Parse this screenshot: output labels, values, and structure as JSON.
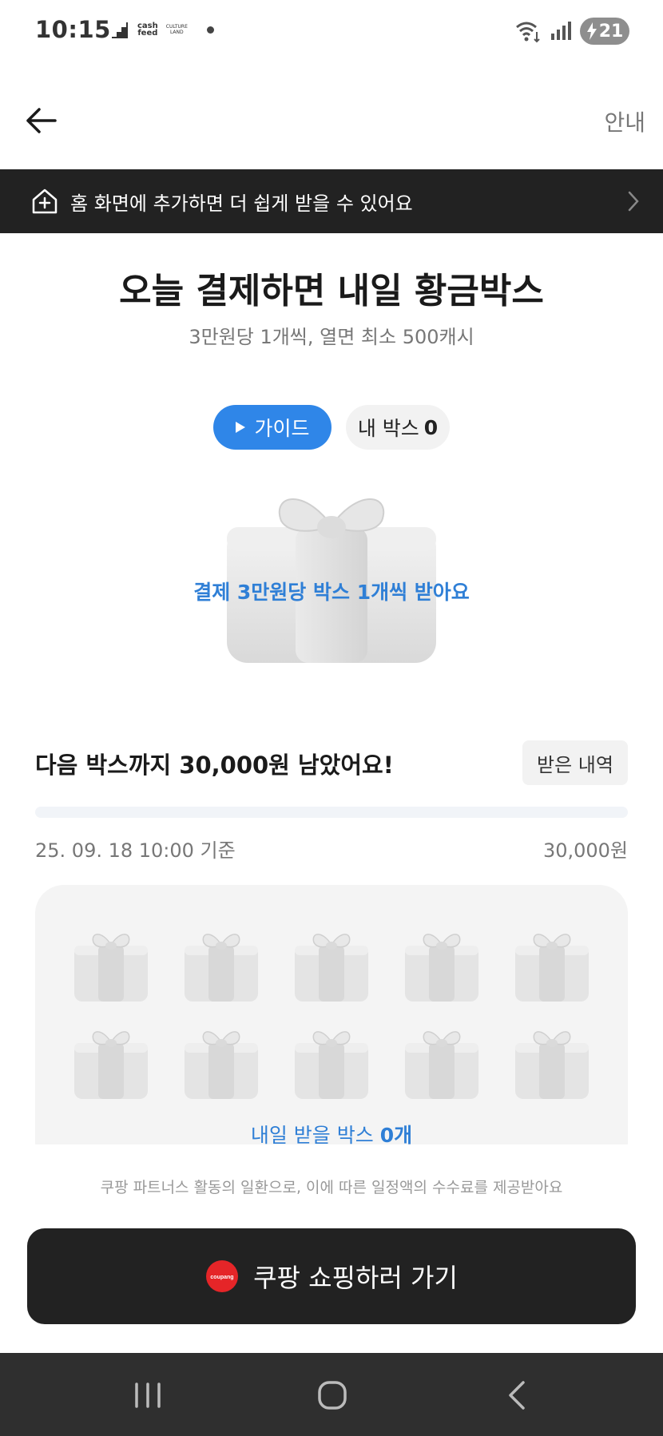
{
  "status_bar": {
    "time": "10:15",
    "app_icons": [
      "cashfeed",
      "cultureland"
    ],
    "cash_label_1": "cash",
    "cash_label_2": "feed",
    "culture_label_1": "CULTURE",
    "culture_label_2": "LAND",
    "battery": "21"
  },
  "top_bar": {
    "back_icon": "arrow-left-icon",
    "info_label": "안내"
  },
  "banner": {
    "icon": "home-add-icon",
    "text": "홈 화면에 추가하면 더 쉽게 받을 수 있어요",
    "chevron_icon": "chevron-right-icon"
  },
  "hero": {
    "title": "오늘 결제하면 내일 황금박스",
    "subtitle": "3만원당 1개씩, 열면 최소 500캐시",
    "guide_label": "가이드",
    "my_box_label": "내 박스",
    "my_box_count": "0",
    "gift_caption": "결제 3만원당 박스 1개씩 받아요"
  },
  "progress": {
    "remaining_text": "다음 박스까지 30,000원 남았어요!",
    "history_label": "받은 내역",
    "fraction_filled": 0.0,
    "as_of": "25. 09. 18 10:00 기준",
    "goal": "30,000원"
  },
  "boxes": {
    "total": 10,
    "tomorrow_label": "내일 받을 박스",
    "tomorrow_count": "0개"
  },
  "disclaimer": "쿠팡 파트너스 활동의 일환으로, 이에 따른 일정액의 수수료를 제공받아요",
  "cta": {
    "logo_text": "coupang",
    "label": "쿠팡 쇼핑하러 가기"
  },
  "nav": {
    "recent_icon": "recent-apps-icon",
    "home_icon": "home-icon",
    "back_icon": "back-icon"
  },
  "colors": {
    "accent": "#2f86e8",
    "caption_blue": "#2f7fd6",
    "dark": "#222222",
    "coupang_red": "#e52528"
  }
}
